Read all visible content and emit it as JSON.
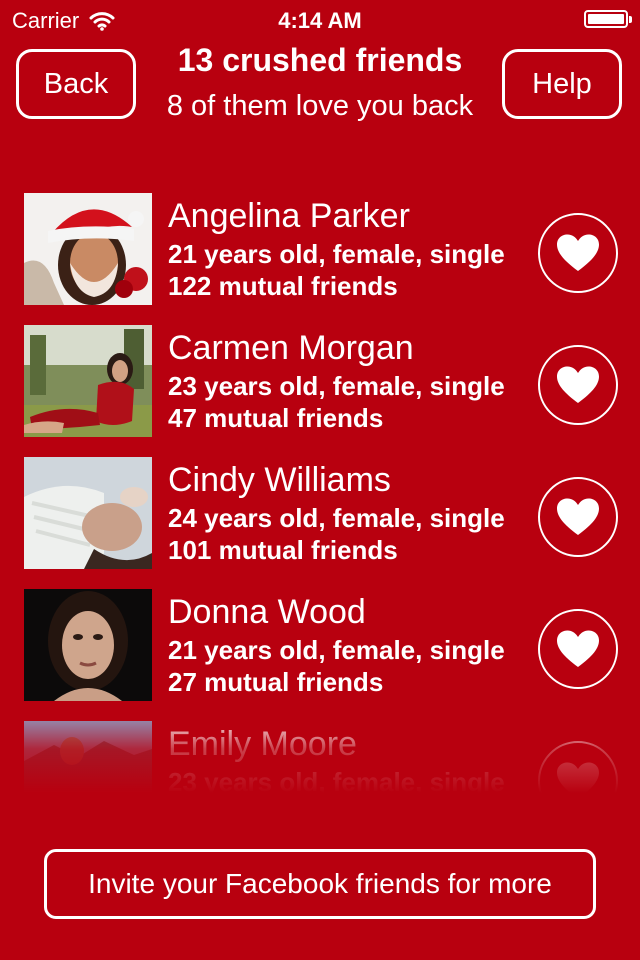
{
  "status_bar": {
    "carrier": "Carrier",
    "time": "4:14 AM"
  },
  "header": {
    "back_label": "Back",
    "title": "13 crushed friends",
    "subtitle": "8 of them love you back",
    "help_label": "Help"
  },
  "friends": [
    {
      "name": "Angelina Parker",
      "info": "21 years old, female, single",
      "mutual": "122 mutual friends"
    },
    {
      "name": "Carmen Morgan",
      "info": "23 years old, female, single",
      "mutual": "47 mutual friends"
    },
    {
      "name": "Cindy Williams",
      "info": "24 years old, female, single",
      "mutual": "101 mutual friends"
    },
    {
      "name": "Donna Wood",
      "info": "21 years old, female, single",
      "mutual": "27 mutual friends"
    },
    {
      "name": "Emily Moore",
      "info": "23 years old, female, single",
      "mutual": ""
    }
  ],
  "invite_label": "Invite your Facebook friends for more",
  "colors": {
    "background": "#b8000f",
    "foreground": "#ffffff"
  },
  "icons": {
    "wifi": "wifi-icon",
    "battery": "battery-icon",
    "heart": "heart-icon"
  }
}
